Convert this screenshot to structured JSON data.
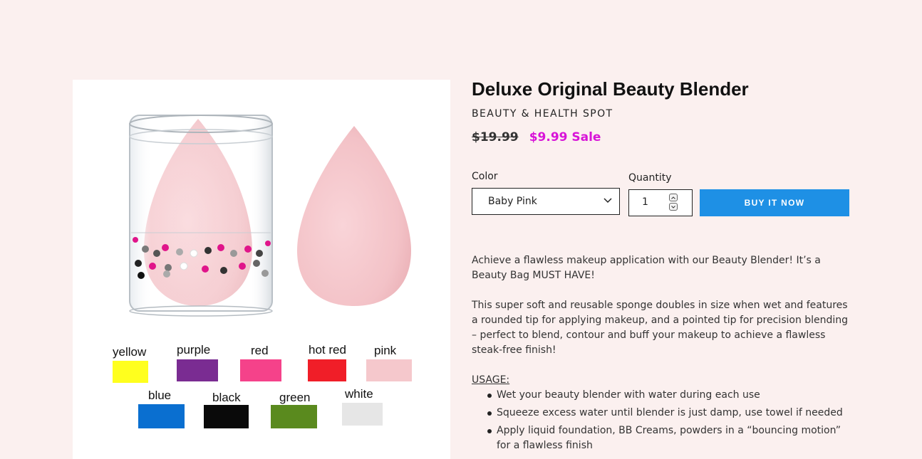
{
  "product": {
    "title": "Deluxe Original Beauty Blender",
    "vendor": "BEAUTY & HEALTH SPOT",
    "price_original": "$19.99",
    "price_sale": "$9.99 Sale"
  },
  "options": {
    "color_label": "Color",
    "color_value": "Baby Pink",
    "quantity_label": "Quantity",
    "quantity_value": "1",
    "buy_label": "BUY IT NOW"
  },
  "image": {
    "swatches": [
      {
        "label": "yellow",
        "color": "#ffff1e"
      },
      {
        "label": "purple",
        "color": "#7a2c92"
      },
      {
        "label": "red",
        "color": "#f5428a"
      },
      {
        "label": "hot red",
        "color": "#f01e28"
      },
      {
        "label": "pink",
        "color": "#f5c8cc"
      },
      {
        "label": "blue",
        "color": "#0a6fd0"
      },
      {
        "label": "black",
        "color": "#0a0a0a"
      },
      {
        "label": "green",
        "color": "#5a8a1e"
      },
      {
        "label": "white",
        "color": "#e6e6e6"
      }
    ],
    "sponge_color": "#f4c3c8"
  },
  "description": {
    "p1": "Achieve a flawless makeup application with our Beauty Blender! It’s a Beauty Bag MUST HAVE!",
    "p2": "This super soft and reusable sponge doubles in size when wet and features a rounded tip for applying makeup, and a pointed tip for precision blending – perfect to blend, contour and buff your makeup to achieve a flawless steak-free finish!",
    "usage_heading": "USAGE:",
    "usage": [
      "Wet your beauty blender with water during each use",
      "Squeeze excess water until blender is just damp, use towel if needed",
      "Apply liquid foundation, BB Creams, powders in a “bouncing motion” for a flawless finish"
    ]
  },
  "colors": {
    "background": "#fbf0ef",
    "sale_price": "#d814d8",
    "buy_button": "#1e90e5"
  }
}
